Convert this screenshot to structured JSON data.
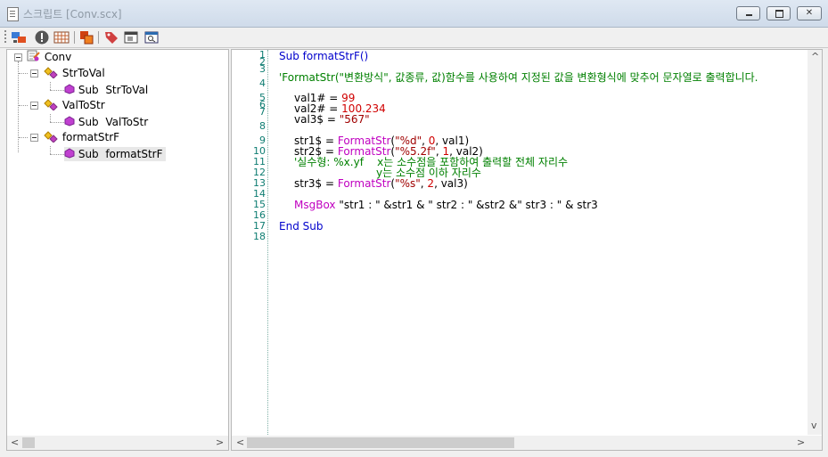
{
  "window": {
    "title": "스크립트 [Conv.scx]"
  },
  "toolbar": {
    "icons": [
      "run-script-icon",
      "stop-icon",
      "grid-icon",
      "copy-icon",
      "tag-icon",
      "window-icon",
      "preview-icon"
    ]
  },
  "tree": {
    "root": {
      "label": "Conv"
    },
    "groups": [
      {
        "label": "StrToVal",
        "child_kind": "Sub",
        "child_name": "StrToVal"
      },
      {
        "label": "ValToStr",
        "child_kind": "Sub",
        "child_name": "ValToStr"
      },
      {
        "label": "formatStrF",
        "child_kind": "Sub",
        "child_name": "formatStrF"
      }
    ]
  },
  "editor": {
    "line_numbers": [
      "1",
      "2",
      "3",
      "4",
      "5",
      "6",
      "7",
      "8",
      "9",
      "10",
      "11",
      "12",
      "13",
      "14",
      "15",
      "16",
      "17",
      "18"
    ],
    "code": {
      "l1_kw": "Sub",
      "l1_rest": " formatStrF()",
      "l3": "'FormatStr(\"변환방식\", 값종류, 값)함수를 사용하여 지정된 값을 변환형식에 맞추어 문자열로 출력합니다.",
      "l5_var": "val1# = ",
      "l5_num": "99",
      "l6_var": "val2# = ",
      "l6_num": "100.234",
      "l7_var": "val3$ = ",
      "l7_str": "\"567\"",
      "l9_var": "str1$ = ",
      "l9_fn": "FormatStr",
      "l9_a": "(",
      "l9_s": "\"%d\"",
      "l9_b": ", ",
      "l9_n": "0",
      "l9_c": ", val1)",
      "l10_var": "str2$ = ",
      "l10_fn": "FormatStr",
      "l10_a": "(",
      "l10_s": "\"%5.2f\"",
      "l10_b": ", ",
      "l10_n": "1",
      "l10_c": ", val2)",
      "l11": "'실수형: %x.yf    x는 소수점을 포함하여 출력할 전체 자리수",
      "l12": "y는 소수점 이하 자리수",
      "l13_var": "str3$ = ",
      "l13_fn": "FormatStr",
      "l13_a": "(",
      "l13_s": "\"%s\"",
      "l13_b": ", ",
      "l13_n": "2",
      "l13_c": ", val3)",
      "l15_fn": "MsgBox",
      "l15_s1": " \"str1 : \"",
      "l15_a": " &str1 & ",
      "l15_s2": "\" str2 : \"",
      "l15_b": " &str2 &",
      "l15_s3": "\" str3 : \"",
      "l15_c": " & str3",
      "l17_kw": "End Sub"
    }
  },
  "scroll": {
    "left": "<",
    "right": ">",
    "up": "^",
    "down": "v"
  },
  "colors": {
    "keyword": "#0000cc",
    "function": "#c000c0",
    "string": "#a00000",
    "number": "#d00000",
    "comment": "#008000"
  }
}
